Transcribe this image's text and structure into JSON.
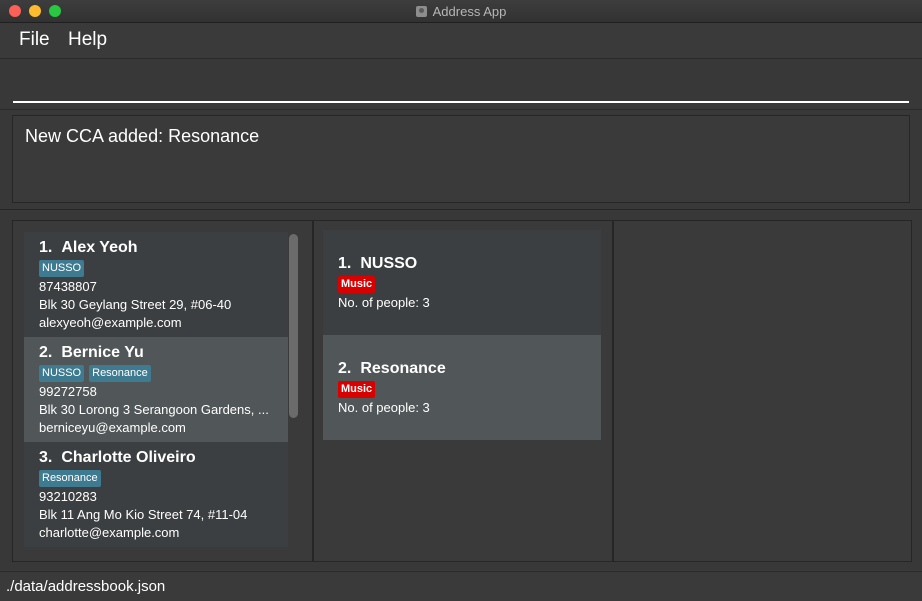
{
  "window": {
    "title": "Address App"
  },
  "menu": {
    "file": "File",
    "help": "Help"
  },
  "command": {
    "value": "",
    "placeholder": ""
  },
  "result": {
    "message": "New CCA added: Resonance"
  },
  "persons": [
    {
      "index": "1.",
      "name": "Alex Yeoh",
      "tags": [
        "NUSSO"
      ],
      "phone": "87438807",
      "address": "Blk 30 Geylang Street 29, #06-40",
      "email": "alexyeoh@example.com"
    },
    {
      "index": "2.",
      "name": "Bernice Yu",
      "tags": [
        "NUSSO",
        "Resonance"
      ],
      "phone": "99272758",
      "address": "Blk 30 Lorong 3 Serangoon Gardens, ...",
      "email": "berniceyu@example.com"
    },
    {
      "index": "3.",
      "name": "Charlotte Oliveiro",
      "tags": [
        "Resonance"
      ],
      "phone": "93210283",
      "address": "Blk 11 Ang Mo Kio Street 74, #11-04",
      "email": "charlotte@example.com"
    }
  ],
  "ccas": [
    {
      "index": "1.",
      "name": "NUSSO",
      "tag": "Music",
      "people": "No. of people: 3"
    },
    {
      "index": "2.",
      "name": "Resonance",
      "tag": "Music",
      "people": "No. of people: 3"
    }
  ],
  "status": {
    "path": "./data/addressbook.json"
  },
  "colors": {
    "tag_blue": "#3e7b91",
    "tag_red": "#d90000",
    "card_bg": "#3c3f41",
    "card_alt_bg": "#515658"
  }
}
